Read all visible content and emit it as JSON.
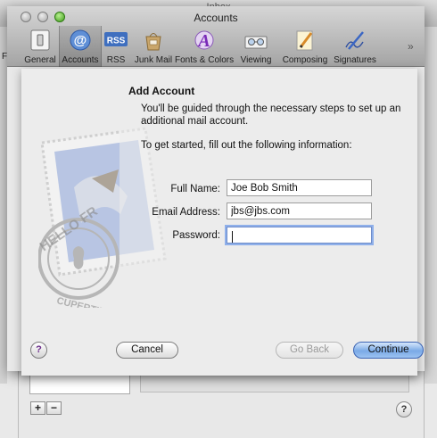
{
  "background_window": {
    "title": "Inbox",
    "from_column_fragment": "Fr"
  },
  "window": {
    "title": "Accounts"
  },
  "toolbar": {
    "items": [
      {
        "label": "General",
        "icon": "light-switch-icon",
        "selected": false
      },
      {
        "label": "Accounts",
        "icon": "at-sign-icon",
        "selected": true
      },
      {
        "label": "RSS",
        "icon": "rss-icon",
        "selected": false
      },
      {
        "label": "Junk Mail",
        "icon": "junk-mail-bag-icon",
        "selected": false
      },
      {
        "label": "Fonts & Colors",
        "icon": "fonts-colors-icon",
        "selected": false
      },
      {
        "label": "Viewing",
        "icon": "glasses-icon",
        "selected": false
      },
      {
        "label": "Composing",
        "icon": "pencil-paper-icon",
        "selected": false
      },
      {
        "label": "Signatures",
        "icon": "signature-pen-icon",
        "selected": false
      }
    ],
    "overflow_glyph": "»"
  },
  "sheet": {
    "heading": "Add Account",
    "intro": "You'll be guided through the necessary steps to set up an additional mail account.",
    "instruction": "To get started, fill out the following information:",
    "fields": {
      "full_name": {
        "label": "Full Name:",
        "value": "Joe Bob Smith"
      },
      "email": {
        "label": "Email Address:",
        "value": "jbs@jbs.com"
      },
      "password": {
        "label": "Password:",
        "value": ""
      }
    },
    "stamp_text": {
      "top": "HELLO FR",
      "bottom": "CUPERTINO"
    },
    "buttons": {
      "help": "?",
      "cancel": "Cancel",
      "go_back": "Go Back",
      "continue": "Continue"
    }
  },
  "accounts_pane": {
    "add_button": "+",
    "remove_button": "−",
    "help_button": "?"
  },
  "colors": {
    "accent_blue": "#7aa9e6",
    "focus_ring": "#8fb0ea",
    "zoom_green": "#3f9b1b"
  }
}
